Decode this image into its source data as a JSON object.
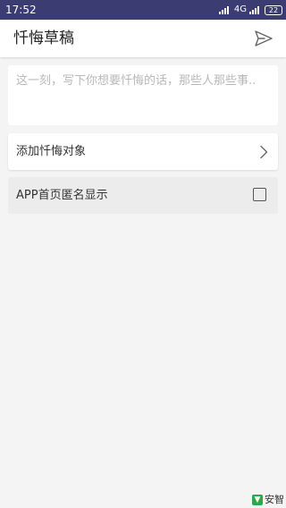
{
  "status_bar": {
    "time": "17:52",
    "network": "4G",
    "battery": "22"
  },
  "app_bar": {
    "title": "忏悔草稿",
    "send_icon": "send-icon"
  },
  "confession": {
    "placeholder": "这一刻，写下你想要忏悔的话，那些人那些事..",
    "value": ""
  },
  "add_target": {
    "label": "添加忏悔对象",
    "icon": "chevron-right-icon"
  },
  "anonymous": {
    "label": "APP首页匿名显示",
    "checked": false
  },
  "watermark": {
    "text": "安智"
  },
  "colors": {
    "status_bar": "#3b3d72",
    "background": "#f4f4f5",
    "watermark_green": "#2aa84a"
  }
}
